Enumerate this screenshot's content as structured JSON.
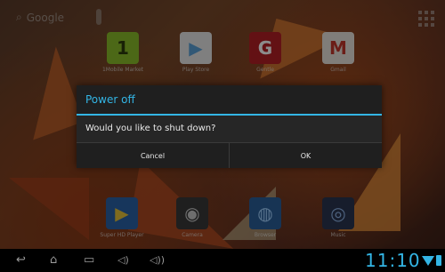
{
  "topbar": {
    "search_label": "Google"
  },
  "apps_top": [
    {
      "label": "1Mobile Market",
      "icon": "1mobile-market-icon",
      "glyph": "1",
      "bg": "#8bbd2a",
      "fg": "#2d3c0b"
    },
    {
      "label": "Play Store",
      "icon": "play-store-icon",
      "glyph": "▶",
      "bg": "#e8e8e8",
      "fg": "#5aa0d8"
    },
    {
      "label": "Gentle",
      "icon": "g-app-icon",
      "glyph": "G",
      "bg": "#b51f25",
      "fg": "#ffffff"
    },
    {
      "label": "Gmail",
      "icon": "gmail-icon",
      "glyph": "M",
      "bg": "#e9e3dc",
      "fg": "#c3362b"
    }
  ],
  "apps_dock": [
    {
      "label": "Super HD Player",
      "icon": "video-player-icon",
      "glyph": "▶",
      "bg": "#2a63a8",
      "fg": "#e8c33a"
    },
    {
      "label": "Camera",
      "icon": "camera-icon",
      "glyph": "◉",
      "bg": "#3a3a3a",
      "fg": "#c8c8c8"
    },
    {
      "label": "Browser",
      "icon": "browser-globe-icon",
      "glyph": "◍",
      "bg": "#2b5f9a",
      "fg": "#9fd0ff"
    },
    {
      "label": "Music",
      "icon": "music-speaker-icon",
      "glyph": "◎",
      "bg": "#2a3550",
      "fg": "#8fb4e8"
    }
  ],
  "dialog": {
    "title": "Power off",
    "message": "Would you like to shut down?",
    "cancel_label": "Cancel",
    "ok_label": "OK"
  },
  "status": {
    "time": "11:10"
  },
  "colors": {
    "accent": "#33b5e5",
    "dialog_bg": "#1f1f1f"
  }
}
